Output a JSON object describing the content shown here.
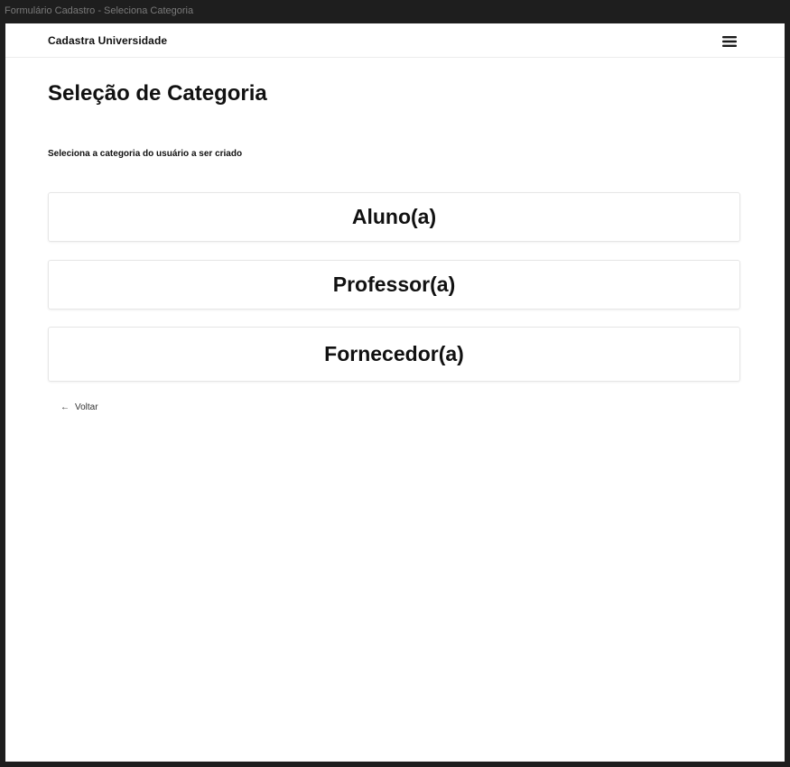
{
  "window": {
    "title": "Formulário Cadastro - Seleciona Categoria"
  },
  "header": {
    "brand": "Cadastra Universidade",
    "menu_icon": "hamburger-menu-icon"
  },
  "main": {
    "title": "Seleção de Categoria",
    "subtitle": "Seleciona a categoria do usuário a ser criado",
    "categories": [
      {
        "label": "Aluno(a)"
      },
      {
        "label": "Professor(a)"
      },
      {
        "label": "Fornecedor(a)"
      }
    ],
    "back": {
      "icon": "arrow-left-icon",
      "arrow_glyph": "←",
      "label": "Voltar"
    }
  },
  "colors": {
    "background": "#ffffff",
    "frame": "#1e1e1e",
    "text": "#111111",
    "border": "#e6e6e6"
  }
}
